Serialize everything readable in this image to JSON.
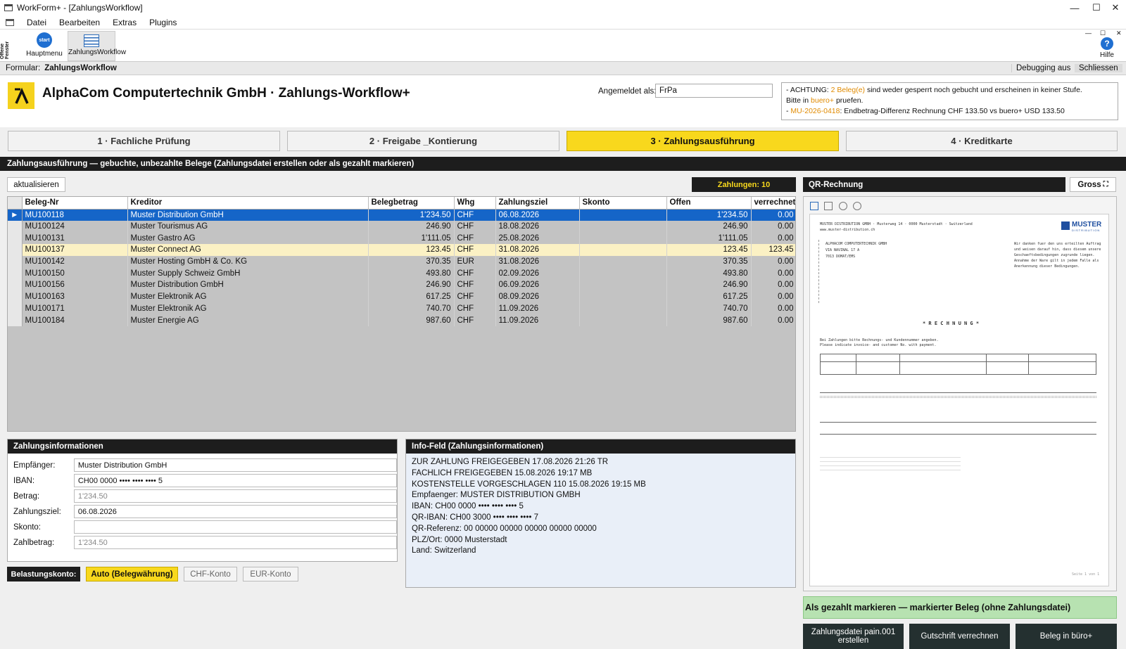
{
  "window": {
    "title": "WorkForm+ - [ZahlungsWorkflow]"
  },
  "menu": [
    "Datei",
    "Bearbeiten",
    "Extras",
    "Plugins"
  ],
  "toolbar": {
    "side_label": "Offene Fenster",
    "start_badge": "start",
    "hauptmenu": "Hauptmenu",
    "workflow": "ZahlungsWorkflow",
    "help": "Hilfe",
    "help_icon": "?"
  },
  "formbar": {
    "label": "Formular:",
    "value": "ZahlungsWorkflow",
    "debug": "Debugging aus",
    "close": "Schliessen"
  },
  "header": {
    "title": "AlphaCom Computertechnik GmbH · Zahlungs-Workflow+",
    "logged_label": "Angemeldet als:",
    "user": "FrPa",
    "warn": {
      "l1a": "- ACHTUNG: ",
      "l1b": "2 Beleg(e)",
      "l1c": " sind weder gesperrt noch gebucht und erscheinen in keiner Stufe.",
      "l2a": "Bitte in ",
      "l2b": "buero+",
      "l2c": " pruefen.",
      "l3a": "- ",
      "l3b": "MU-2026-0418",
      "l3c": ": Endbetrag-Differenz Rechnung CHF 133.50 vs buero+ USD 133.50"
    }
  },
  "tabs": [
    "1 · Fachliche Prüfung",
    "2 · Freigabe _Kontierung",
    "3 · Zahlungsausführung",
    "4 · Kreditkarte"
  ],
  "section_title": "Zahlungsausführung — gebuchte, unbezahlte Belege (Zahlungsdatei erstellen oder als gezahlt markieren)",
  "refresh": "aktualisieren",
  "count": "Zahlungen: 10",
  "table": {
    "columns": [
      "Beleg-Nr",
      "Kreditor",
      "Belegbetrag",
      "Whg",
      "Zahlungsziel",
      "Skonto",
      "Offen",
      "verrechnet"
    ],
    "selected_marker": "▶",
    "rows": [
      [
        "MU100118",
        "Muster Distribution GmbH",
        "1'234.50",
        "CHF",
        "06.08.2026",
        "",
        "1'234.50",
        "0.00"
      ],
      [
        "MU100124",
        "Muster Tourismus AG",
        "246.90",
        "CHF",
        "18.08.2026",
        "",
        "246.90",
        "0.00"
      ],
      [
        "MU100131",
        "Muster Gastro AG",
        "1'111.05",
        "CHF",
        "25.08.2026",
        "",
        "1'111.05",
        "0.00"
      ],
      [
        "MU100137",
        "Muster Connect AG",
        "123.45",
        "CHF",
        "31.08.2026",
        "",
        "123.45",
        "123.45"
      ],
      [
        "MU100142",
        "Muster Hosting GmbH & Co. KG",
        "370.35",
        "EUR",
        "31.08.2026",
        "",
        "370.35",
        "0.00"
      ],
      [
        "MU100150",
        "Muster Supply Schweiz GmbH",
        "493.80",
        "CHF",
        "02.09.2026",
        "",
        "493.80",
        "0.00"
      ],
      [
        "MU100156",
        "Muster Distribution GmbH",
        "246.90",
        "CHF",
        "06.09.2026",
        "",
        "246.90",
        "0.00"
      ],
      [
        "MU100163",
        "Muster Elektronik AG",
        "617.25",
        "CHF",
        "08.09.2026",
        "",
        "617.25",
        "0.00"
      ],
      [
        "MU100171",
        "Muster Elektronik AG",
        "740.70",
        "CHF",
        "11.09.2026",
        "",
        "740.70",
        "0.00"
      ],
      [
        "MU100184",
        "Muster Energie AG",
        "987.60",
        "CHF",
        "11.09.2026",
        "",
        "987.60",
        "0.00"
      ]
    ]
  },
  "zahlinfo": {
    "title": "Zahlungsinformationen",
    "fields": [
      {
        "label": "Empfänger:",
        "value": "Muster Distribution GmbH"
      },
      {
        "label": "IBAN:",
        "value": "CH00 0000 •••• •••• •••• 5"
      },
      {
        "label": "Betrag:",
        "value": "1'234.50"
      },
      {
        "label": "Zahlungsziel:",
        "value": "06.08.2026"
      },
      {
        "label": "Skonto:",
        "value": ""
      },
      {
        "label": "Zahlbetrag:",
        "value": "1'234.50"
      }
    ]
  },
  "konto": {
    "label": "Belastungskonto:",
    "auto": "Auto (Belegwährung)",
    "chf": "CHF-Konto",
    "eur": "EUR-Konto"
  },
  "infofeld": {
    "title": "Info-Feld (Zahlungsinformationen)",
    "lines": [
      "ZUR ZAHLUNG FREIGEGEBEN 17.08.2026 21:26 TR",
      "FACHLICH FREIGEGEBEN 15.08.2026 19:17 MB",
      "KOSTENSTELLE VORGESCHLAGEN 110 15.08.2026 19:15 MB",
      "Empfaenger: MUSTER DISTRIBUTION GMBH",
      "IBAN: CH00 0000 •••• •••• •••• 5",
      "QR-IBAN: CH00 3000 •••• •••• •••• 7",
      "QR-Referenz: 00 00000 00000 00000 00000 00000",
      "PLZ/Ort: 0000 Musterstadt",
      "Land: Switzerland"
    ]
  },
  "qr": {
    "title": "QR-Rechnung",
    "gross": "Gross",
    "doc": {
      "sender": "MUSTER DISTRIBUTION GMBH · Musterweg 14 · 0000 Musterstadt · Switzerland",
      "web": "www.muster-distribution.ch",
      "brand": "MUSTER",
      "brand_sub": "DISTRIBUTION",
      "addr1": "ALPHACOM COMPUTERTECHNIK GMBH",
      "addr2": "VIA NAVINAL 17 A",
      "addr3": "7013 DOMAT/EMS",
      "thanks1": "Wir danken fuer den uns erteilten Auftrag",
      "thanks2": "und weisen darauf hin, dass diesem unsere",
      "thanks3": "Geschaeftsbedingungen zugrunde liegen.",
      "thanks4": "Annahme der Ware gilt in jedem Falle als",
      "thanks5": "Anerkennung dieser Bedingungen.",
      "heading": "* R E C H N U N G *",
      "note1": "Bei Zahlungen bitte Rechnungs- und Kundennummer angeben.",
      "note2": "Please indicate invoice- and customer No. with payment.",
      "page": "Seite 1 von 1"
    }
  },
  "actions": {
    "mark_paid": "Als gezahlt markieren — markierter Beleg (ohne Zahlungsdatei)",
    "pain_l1": "Zahlungsdatei pain.001",
    "pain_l2": "erstellen",
    "gutschrift": "Gutschrift verrechnen",
    "buero": "Beleg in büro+"
  },
  "colors": {
    "accent": "#f8d81d",
    "selected": "#1565c8",
    "highlight": "#fbf1c4",
    "green": "#b7e2b1",
    "warn": "#e08a00"
  }
}
